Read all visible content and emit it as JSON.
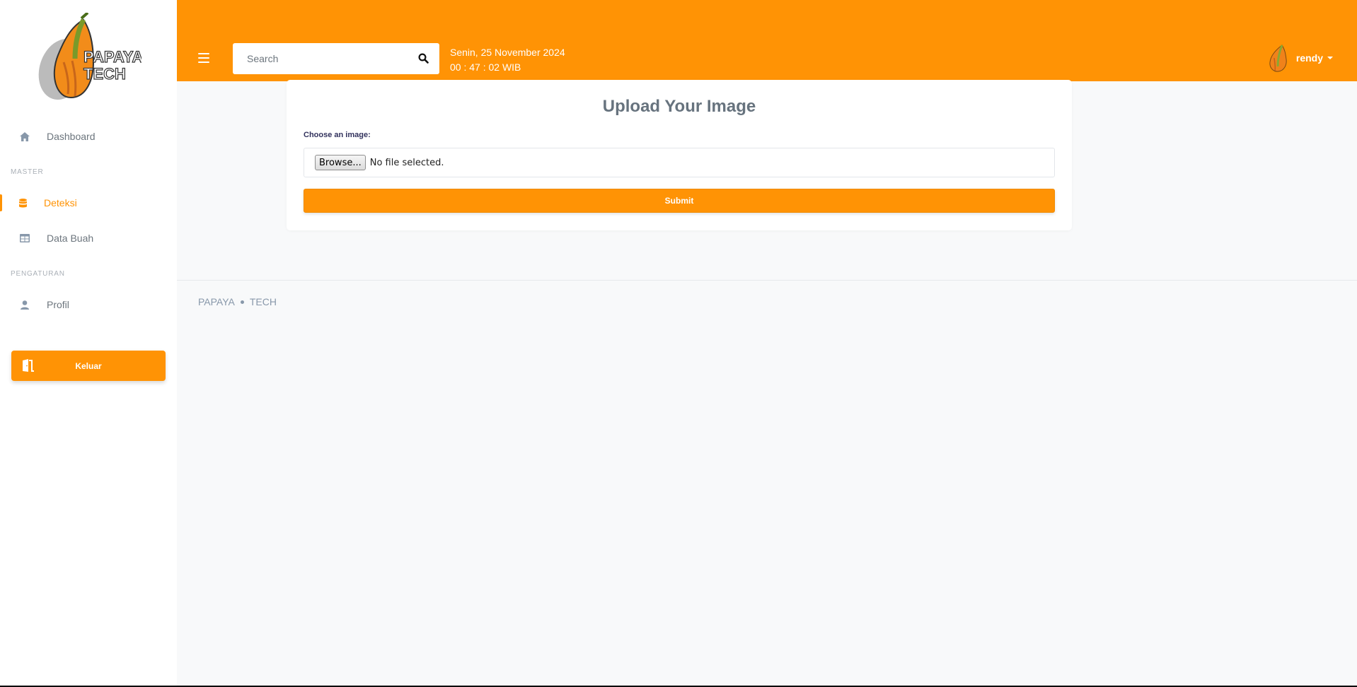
{
  "brand": {
    "logo_line1": "PAPAYA",
    "logo_line2": "TECH"
  },
  "sidebar": {
    "items": [
      {
        "label": "Dashboard",
        "icon": "home-icon"
      },
      {
        "label": "Deteksi",
        "icon": "database-icon",
        "active": true
      },
      {
        "label": "Data Buah",
        "icon": "table-icon"
      },
      {
        "label": "Profil",
        "icon": "user-icon"
      }
    ],
    "sections": {
      "master": "MASTER",
      "settings": "PENGATURAN"
    },
    "logout_label": "Keluar"
  },
  "header": {
    "search_placeholder": "Search",
    "date": "Senin, 25 November 2024",
    "time": "00 : 47 : 02 WIB",
    "username": "rendy"
  },
  "card": {
    "title": "Upload Your Image",
    "field_label": "Choose an image:",
    "browse_label": "Browse...",
    "file_status": "No file selected.",
    "submit_label": "Submit"
  },
  "footer": {
    "left": "PAPAYA",
    "right": "TECH"
  },
  "colors": {
    "accent": "#ff9305",
    "sidebar_bg": "#ffffff",
    "content_bg": "#f8f9fa"
  }
}
